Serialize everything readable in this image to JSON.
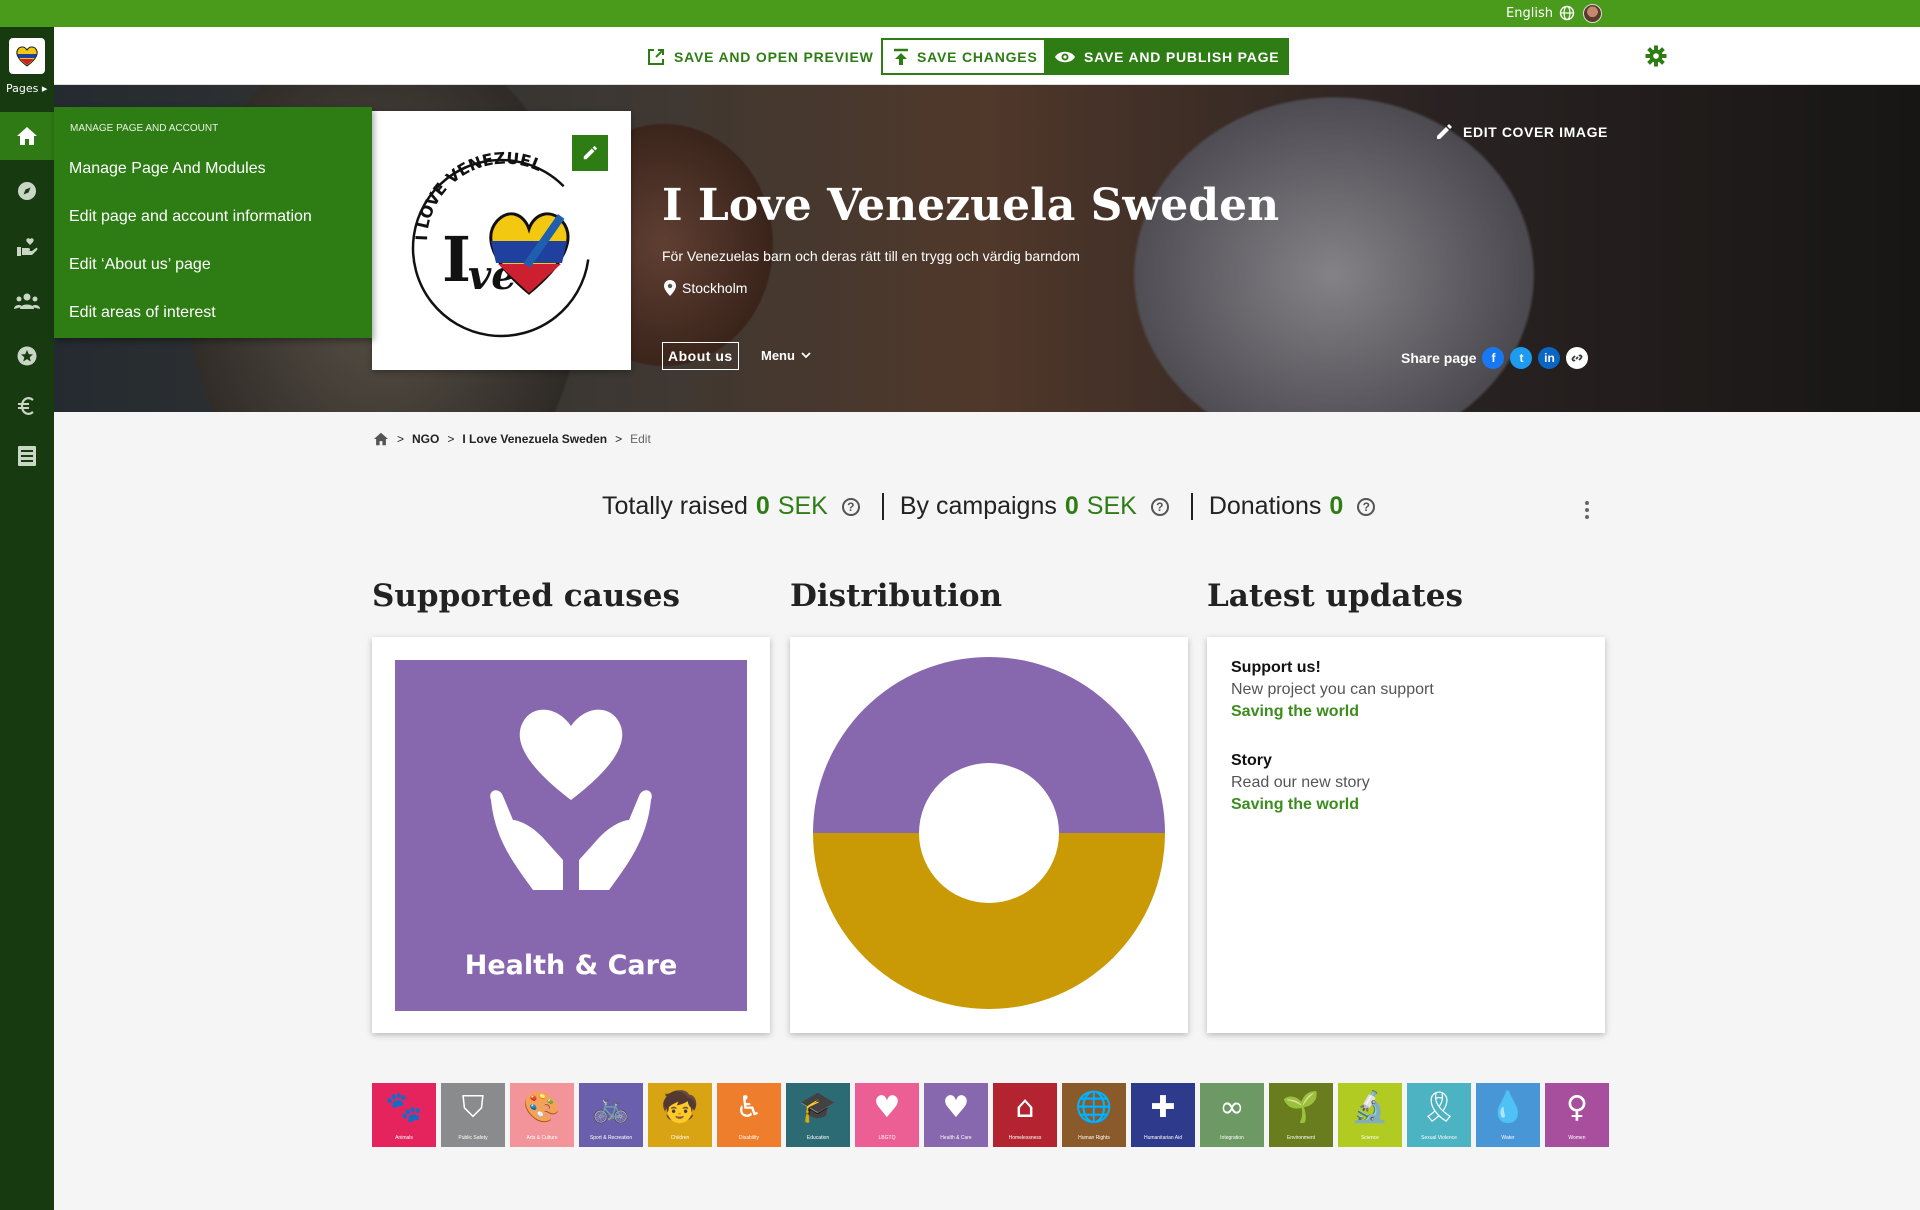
{
  "topbar": {
    "language": "English"
  },
  "sidebar": {
    "pages_label": "Pages"
  },
  "toolbar": {
    "preview_label": "SAVE AND OPEN PREVIEW",
    "save_label": "SAVE CHANGES",
    "publish_label": "SAVE AND PUBLISH PAGE"
  },
  "dropdown": {
    "heading": "MANAGE PAGE AND ACCOUNT",
    "items": [
      "Manage Page And Modules",
      "Edit page and account information",
      "Edit ‘About us’ page",
      "Edit areas of interest"
    ]
  },
  "cover": {
    "edit_cover_label": "EDIT COVER IMAGE",
    "title": "I Love Venezuela Sweden",
    "subtitle": "För Venezuelas barn och deras rätt till en trygg och värdig barndom",
    "location": "Stockholm",
    "about_label": "About us",
    "menu_label": "Menu",
    "share_label": "Share page",
    "logo_text": "I LOVE VENEZUELA SWEDEN"
  },
  "breadcrumb": {
    "items": [
      "NGO",
      "I Love Venezuela Sweden",
      "Edit"
    ]
  },
  "stats": {
    "raised_label": "Totally raised",
    "raised_value": "0",
    "raised_currency": "SEK",
    "campaigns_label": "By campaigns",
    "campaigns_value": "0",
    "campaigns_currency": "SEK",
    "donations_label": "Donations",
    "donations_value": "0"
  },
  "sections": {
    "causes_title": "Supported causes",
    "distribution_title": "Distribution",
    "updates_title": "Latest updates"
  },
  "cause": {
    "label": "Health & Care",
    "color": "#8767ad"
  },
  "chart_data": {
    "type": "pie",
    "series": [
      {
        "value": 50,
        "color": "#8767ad"
      },
      {
        "value": 50,
        "color": "#c99a06"
      }
    ]
  },
  "updates": [
    {
      "title": "Support us!",
      "text": "New project you can support",
      "link": "Saving the world"
    },
    {
      "title": "Story",
      "text": "Read our new story",
      "link": "Saving the world"
    }
  ],
  "causes_row": [
    {
      "label": "Animals",
      "color": "#e5245e",
      "icon": "paw-icon",
      "glyph": "🐾"
    },
    {
      "label": "Public Safety",
      "color": "#8a8b8c",
      "icon": "shield-icon",
      "glyph": "⛉"
    },
    {
      "label": "Arts & Culture",
      "color": "#f3949a",
      "icon": "palette-icon",
      "glyph": "🎨"
    },
    {
      "label": "Sport & Recreation",
      "color": "#6a5fac",
      "icon": "bike-icon",
      "glyph": "🚲"
    },
    {
      "label": "Children",
      "color": "#d8a413",
      "icon": "child-icon",
      "glyph": "🧒"
    },
    {
      "label": "Disability",
      "color": "#ee7d2c",
      "icon": "wheelchair-icon",
      "glyph": "♿"
    },
    {
      "label": "Education",
      "color": "#2d6b74",
      "icon": "graduation-icon",
      "glyph": "🎓"
    },
    {
      "label": "LBGTQ",
      "color": "#ec5f94",
      "icon": "heart-icon",
      "glyph": "♥"
    },
    {
      "label": "Health & Care",
      "color": "#8767ad",
      "icon": "hands-heart-icon",
      "glyph": "♥"
    },
    {
      "label": "Homelessness",
      "color": "#b42330",
      "icon": "house-icon",
      "glyph": "⌂"
    },
    {
      "label": "Human Rights",
      "color": "#8a5a2b",
      "icon": "globe-icon",
      "glyph": "🌐"
    },
    {
      "label": "Humanitarian Aid",
      "color": "#2e3a8c",
      "icon": "parachute-icon",
      "glyph": "✚"
    },
    {
      "label": "Integration",
      "color": "#6d9a64",
      "icon": "link-icon",
      "glyph": "∞"
    },
    {
      "label": "Environment",
      "color": "#6a7d1e",
      "icon": "plant-icon",
      "glyph": "🌱"
    },
    {
      "label": "Science",
      "color": "#b1cb23",
      "icon": "microscope-icon",
      "glyph": "🔬"
    },
    {
      "label": "Sexual Violence",
      "color": "#4cb3c2",
      "icon": "ribbon-icon",
      "glyph": "🎗"
    },
    {
      "label": "Water",
      "color": "#4896d6",
      "icon": "water-drop-icon",
      "glyph": "💧"
    },
    {
      "label": "Women",
      "color": "#a74e9c",
      "icon": "female-icon",
      "glyph": "♀"
    }
  ]
}
